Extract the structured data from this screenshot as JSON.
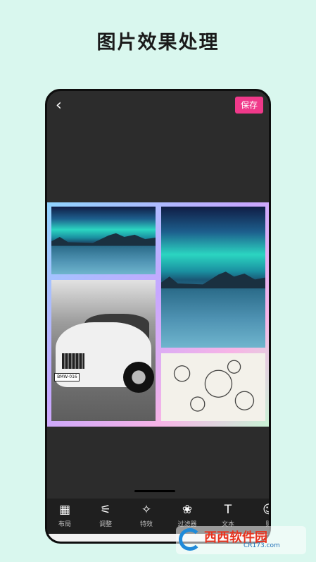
{
  "headline": "图片效果处理",
  "editor": {
    "back_icon": "‹",
    "save_label": "保存",
    "plate_text": "BMW·016"
  },
  "toolbar": [
    {
      "icon": "layout-icon",
      "glyph": "▦",
      "label": "布局"
    },
    {
      "icon": "adjust-icon",
      "glyph": "⚟",
      "label": "调整"
    },
    {
      "icon": "effects-icon",
      "glyph": "✧",
      "label": "特效"
    },
    {
      "icon": "filter-icon",
      "glyph": "❀",
      "label": "过滤器"
    },
    {
      "icon": "text-icon",
      "glyph": "T",
      "label": "文本"
    },
    {
      "icon": "sticker-icon",
      "glyph": "☺",
      "label": "贴"
    }
  ],
  "watermark": {
    "brand": "西西软件园",
    "url": "CR173.com"
  }
}
